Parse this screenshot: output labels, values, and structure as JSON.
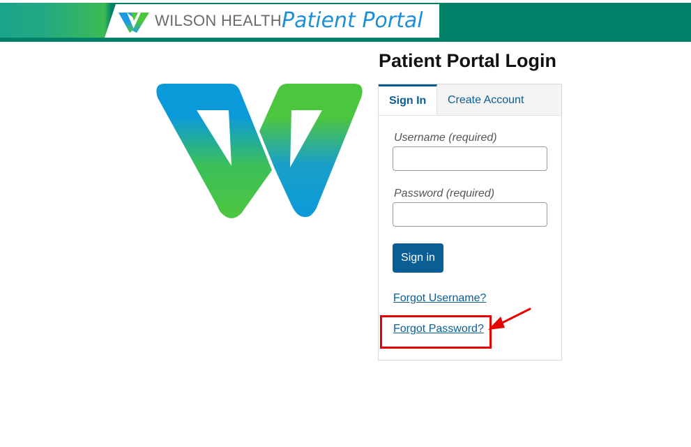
{
  "header": {
    "brand": "WILSON HEALTH",
    "portal": "Patient Portal",
    "colors": {
      "green": "#008066",
      "blue": "#1d8fd6",
      "lime": "#4dc63f"
    }
  },
  "logo": {
    "icon": "wilson-w-logo-icon"
  },
  "login": {
    "title": "Patient Portal Login",
    "tabs": [
      {
        "label": "Sign In",
        "active": true
      },
      {
        "label": "Create Account",
        "active": false
      }
    ],
    "username": {
      "label": "Username (required)",
      "value": "",
      "placeholder": ""
    },
    "password": {
      "label": "Password (required)",
      "value": "",
      "placeholder": ""
    },
    "submit_label": "Sign in",
    "forgot_username": "Forgot Username?",
    "forgot_password": "Forgot Password?"
  },
  "annotation": {
    "color": "#e60000",
    "icon": "red-arrow-icon"
  }
}
